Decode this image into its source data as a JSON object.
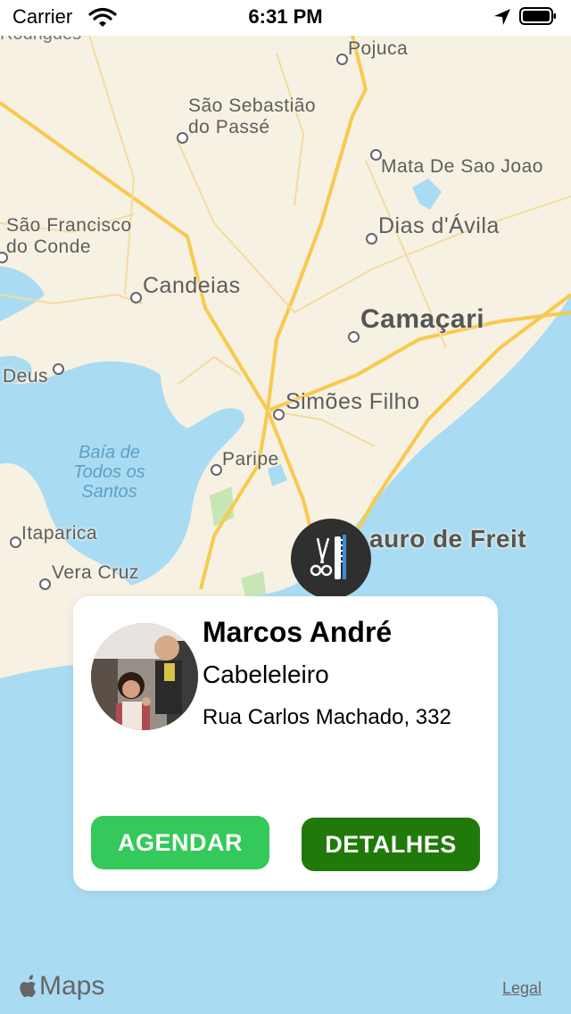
{
  "status_bar": {
    "carrier": "Carrier",
    "time": "6:31 PM"
  },
  "map": {
    "cities": [
      {
        "id": "pojuca",
        "label": "Pojuca"
      },
      {
        "id": "sao-sebastiao",
        "label": "São Sebastião"
      },
      {
        "id": "sao-sebastiao-2",
        "label": "do Passé"
      },
      {
        "id": "mata",
        "label": "Mata De Sao Joao"
      },
      {
        "id": "dias",
        "label": "Dias d'Ávila"
      },
      {
        "id": "sao-francisco",
        "label": "São Francisco"
      },
      {
        "id": "sao-francisco-2",
        "label": "do Conde"
      },
      {
        "id": "candeias",
        "label": "Candeias"
      },
      {
        "id": "camacari",
        "label": "Camaçari"
      },
      {
        "id": "deus",
        "label": "Deus"
      },
      {
        "id": "simoes",
        "label": "Simões Filho"
      },
      {
        "id": "paripe",
        "label": "Paripe"
      },
      {
        "id": "itaparica",
        "label": "Itaparica"
      },
      {
        "id": "vera-cruz",
        "label": "Vera Cruz"
      },
      {
        "id": "lauro",
        "label": "auro de Freit"
      }
    ],
    "bay_label": [
      "Baía de",
      "Todos os",
      "Santos"
    ]
  },
  "pin": {
    "icon": "barber-scissors-comb-icon"
  },
  "card": {
    "name": "Marcos André",
    "profession": "Cabeleleiro",
    "address": "Rua Carlos Machado, 332",
    "agendar_label": "AGENDAR",
    "detalhes_label": "DETALHES"
  },
  "footer": {
    "maps_label": "Maps",
    "legal_label": "Legal"
  },
  "colors": {
    "agendar": "#34c95a",
    "detalhes": "#1f7a0a",
    "water": "#a9dcf2",
    "land": "#f7f1e3",
    "roads": "#f9c94e"
  }
}
